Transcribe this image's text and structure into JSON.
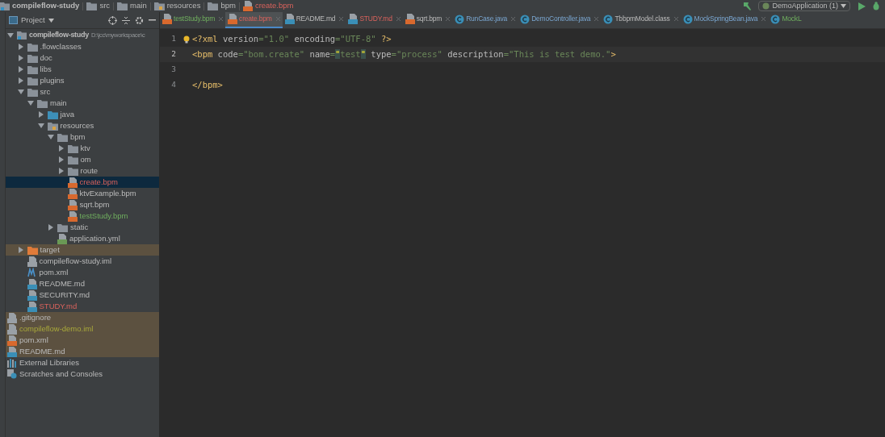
{
  "breadcrumb": [
    {
      "label": "compileflow-study",
      "kind": "project",
      "modified": false
    },
    {
      "label": "src",
      "kind": "folder",
      "modified": false
    },
    {
      "label": "main",
      "kind": "folder",
      "modified": false
    },
    {
      "label": "resources",
      "kind": "resources",
      "modified": false
    },
    {
      "label": "bpm",
      "kind": "folder",
      "modified": false
    },
    {
      "label": "create.bpm",
      "kind": "bpm",
      "modified": true
    }
  ],
  "run_config": {
    "label": "DemoApplication (1)"
  },
  "project_panel": {
    "title": "Project"
  },
  "tabs": [
    {
      "label": "testStudy.bpm",
      "kind": "bpm",
      "modified": false,
      "added": true,
      "selected": false
    },
    {
      "label": "create.bpm",
      "kind": "bpm",
      "modified": true,
      "added": false,
      "selected": true
    },
    {
      "label": "README.md",
      "kind": "md",
      "modified": false,
      "added": false,
      "selected": false
    },
    {
      "label": "STUDY.md",
      "kind": "md",
      "modified": true,
      "added": false,
      "selected": false
    },
    {
      "label": "sqrt.bpm",
      "kind": "bpm",
      "modified": false,
      "added": false,
      "selected": false
    },
    {
      "label": "RunCase.java",
      "kind": "java",
      "modified": false,
      "added": false,
      "selected": false
    },
    {
      "label": "DemoController.java",
      "kind": "java",
      "modified": false,
      "added": false,
      "selected": false
    },
    {
      "label": "TbbpmModel.class",
      "kind": "class",
      "modified": false,
      "added": false,
      "selected": false
    },
    {
      "label": "MockSpringBean.java",
      "kind": "java",
      "modified": false,
      "added": false,
      "selected": false
    },
    {
      "label": "MockL",
      "kind": "java",
      "modified": false,
      "added": true,
      "selected": false
    }
  ],
  "tree": [
    {
      "label": "compileflow-study",
      "kind": "project",
      "path": "D:\\jcc\\myworkspace\\c",
      "modified": false,
      "added": false,
      "ignored": false,
      "selected": false,
      "excluded": false,
      "expanded": true,
      "children": [
        {
          "label": ".flowclasses",
          "kind": "folder",
          "modified": false,
          "added": false,
          "ignored": false,
          "selected": false,
          "excluded": false,
          "expanded": false
        },
        {
          "label": "doc",
          "kind": "folder",
          "modified": false,
          "added": false,
          "ignored": false,
          "selected": false,
          "excluded": false,
          "expanded": false
        },
        {
          "label": "libs",
          "kind": "folder",
          "modified": false,
          "added": false,
          "ignored": false,
          "selected": false,
          "excluded": false,
          "expanded": false
        },
        {
          "label": "plugins",
          "kind": "folder",
          "modified": false,
          "added": false,
          "ignored": false,
          "selected": false,
          "excluded": false,
          "expanded": false
        },
        {
          "label": "src",
          "kind": "folder",
          "modified": false,
          "added": false,
          "ignored": false,
          "selected": false,
          "excluded": false,
          "expanded": true,
          "children": [
            {
              "label": "main",
              "kind": "folder",
              "modified": false,
              "added": false,
              "ignored": false,
              "selected": false,
              "excluded": false,
              "expanded": true,
              "children": [
                {
                  "label": "java",
                  "kind": "source",
                  "modified": false,
                  "added": false,
                  "ignored": false,
                  "selected": false,
                  "excluded": false,
                  "expanded": false
                },
                {
                  "label": "resources",
                  "kind": "resources",
                  "modified": false,
                  "added": false,
                  "ignored": false,
                  "selected": false,
                  "excluded": false,
                  "expanded": true,
                  "children": [
                    {
                      "label": "bpm",
                      "kind": "folder",
                      "modified": false,
                      "added": false,
                      "ignored": false,
                      "selected": false,
                      "excluded": false,
                      "expanded": true,
                      "children": [
                        {
                          "label": "ktv",
                          "kind": "folder",
                          "modified": false,
                          "added": false,
                          "ignored": false,
                          "selected": false,
                          "excluded": false,
                          "expanded": false
                        },
                        {
                          "label": "om",
                          "kind": "folder",
                          "modified": false,
                          "added": false,
                          "ignored": false,
                          "selected": false,
                          "excluded": false,
                          "expanded": false
                        },
                        {
                          "label": "route",
                          "kind": "folder",
                          "modified": false,
                          "added": false,
                          "ignored": false,
                          "selected": false,
                          "excluded": false,
                          "expanded": false
                        },
                        {
                          "label": "create.bpm",
                          "kind": "bpm",
                          "modified": true,
                          "added": false,
                          "ignored": false,
                          "selected": true,
                          "excluded": false
                        },
                        {
                          "label": "ktvExample.bpm",
                          "kind": "bpm",
                          "modified": false,
                          "added": false,
                          "ignored": false,
                          "selected": false,
                          "excluded": false
                        },
                        {
                          "label": "sqrt.bpm",
                          "kind": "bpm",
                          "modified": false,
                          "added": false,
                          "ignored": false,
                          "selected": false,
                          "excluded": false
                        },
                        {
                          "label": "testStudy.bpm",
                          "kind": "bpm",
                          "modified": false,
                          "added": true,
                          "ignored": false,
                          "selected": false,
                          "excluded": false
                        }
                      ]
                    },
                    {
                      "label": "static",
                      "kind": "folder",
                      "modified": false,
                      "added": false,
                      "ignored": false,
                      "selected": false,
                      "excluded": false,
                      "expanded": false
                    },
                    {
                      "label": "application.yml",
                      "kind": "yml",
                      "modified": false,
                      "added": false,
                      "ignored": false,
                      "selected": false,
                      "excluded": false
                    }
                  ]
                }
              ]
            }
          ]
        },
        {
          "label": "target",
          "kind": "excluded-folder",
          "modified": false,
          "added": false,
          "ignored": false,
          "selected": false,
          "excluded": true,
          "expanded": false
        },
        {
          "label": "compileflow-study.iml",
          "kind": "iml",
          "modified": false,
          "added": false,
          "ignored": false,
          "selected": false,
          "excluded": false
        },
        {
          "label": "pom.xml",
          "kind": "maven",
          "modified": false,
          "added": false,
          "ignored": false,
          "selected": false,
          "excluded": false
        },
        {
          "label": "README.md",
          "kind": "md",
          "modified": false,
          "added": false,
          "ignored": false,
          "selected": false,
          "excluded": false
        },
        {
          "label": "SECURITY.md",
          "kind": "md",
          "modified": false,
          "added": false,
          "ignored": false,
          "selected": false,
          "excluded": false
        },
        {
          "label": "STUDY.md",
          "kind": "md",
          "modified": true,
          "added": false,
          "ignored": false,
          "selected": false,
          "excluded": false
        }
      ]
    },
    {
      "label": ".gitignore",
      "kind": "text",
      "modified": false,
      "added": false,
      "ignored": false,
      "selected": false,
      "excluded": true
    },
    {
      "label": "compileflow-demo.iml",
      "kind": "iml",
      "modified": false,
      "added": false,
      "ignored": true,
      "selected": false,
      "excluded": true
    },
    {
      "label": "pom.xml",
      "kind": "bpm",
      "modified": false,
      "added": false,
      "ignored": false,
      "selected": false,
      "excluded": true
    },
    {
      "label": "README.md",
      "kind": "md",
      "modified": false,
      "added": false,
      "ignored": false,
      "selected": false,
      "excluded": true
    },
    {
      "label": "External Libraries",
      "kind": "library",
      "modified": false,
      "added": false,
      "ignored": false,
      "selected": false,
      "excluded": false
    },
    {
      "label": "Scratches and Consoles",
      "kind": "scratch",
      "modified": false,
      "added": false,
      "ignored": false,
      "selected": false,
      "excluded": false
    }
  ],
  "editor": {
    "lines": [
      {
        "number": "1",
        "current": false,
        "tokens": [
          {
            "text": "<?xml",
            "kind": "tag"
          },
          {
            "text": " version",
            "kind": "attr"
          },
          {
            "text": "=\"1.0\"",
            "kind": "value"
          },
          {
            "text": " encoding",
            "kind": "attr"
          },
          {
            "text": "=\"UTF-8\"",
            "kind": "value"
          },
          {
            "text": " ?>",
            "kind": "tag"
          }
        ]
      },
      {
        "number": "2",
        "current": true,
        "tokens": [
          {
            "text": "<bpm",
            "kind": "tag"
          },
          {
            "text": " code",
            "kind": "attr"
          },
          {
            "text": "=\"bom.create\"",
            "kind": "value"
          },
          {
            "text": " name",
            "kind": "attr"
          },
          {
            "text": "=",
            "kind": "value"
          },
          {
            "text": "\"",
            "kind": "match"
          },
          {
            "text": "test",
            "kind": "value"
          },
          {
            "text": "\"",
            "kind": "match"
          },
          {
            "text": " type",
            "kind": "attr"
          },
          {
            "text": "=\"process\"",
            "kind": "value"
          },
          {
            "text": " description",
            "kind": "attr"
          },
          {
            "text": "=\"This is test demo.\"",
            "kind": "value"
          },
          {
            "text": ">",
            "kind": "tag"
          }
        ]
      },
      {
        "number": "3",
        "current": false
      },
      {
        "number": "4",
        "current": false,
        "tokens": [
          {
            "text": "</bpm>",
            "kind": "tag"
          }
        ]
      }
    ]
  }
}
